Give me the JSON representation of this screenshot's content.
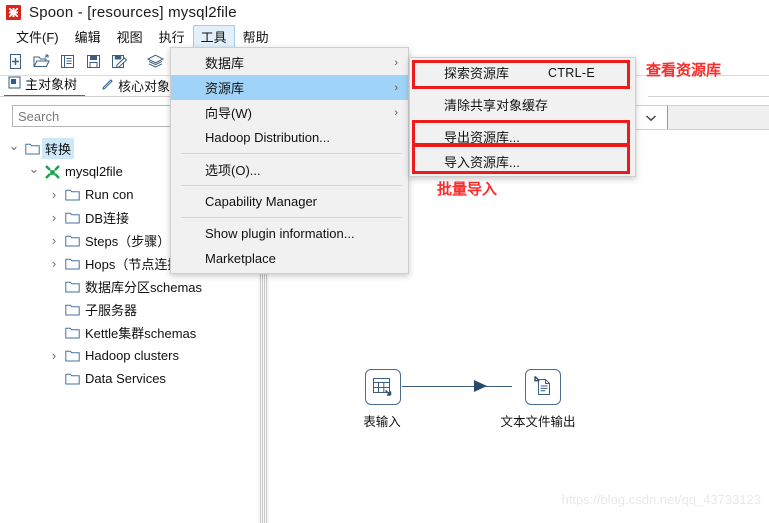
{
  "window": {
    "title": "Spoon - [resources] mysql2file",
    "logo_icon": "spoon-logo-icon"
  },
  "menubar": {
    "items": [
      {
        "label": "文件(F)",
        "active": false
      },
      {
        "label": "编辑",
        "active": false
      },
      {
        "label": "视图",
        "active": false
      },
      {
        "label": "执行",
        "active": false
      },
      {
        "label": "工具",
        "active": true
      },
      {
        "label": "帮助",
        "active": false
      }
    ]
  },
  "toolbar": {
    "buttons": [
      {
        "name": "new-file-icon",
        "title": "新建"
      },
      {
        "name": "open-file-icon",
        "title": "打开"
      },
      {
        "name": "explore-icon",
        "title": "浏览"
      },
      {
        "name": "save-icon",
        "title": "保存"
      },
      {
        "name": "save-as-icon",
        "title": "另存为"
      },
      {
        "name": "layers-icon",
        "title": "图层"
      }
    ]
  },
  "left_panel": {
    "tabs": [
      {
        "label": "主对象树",
        "icon": "tree-view-icon",
        "selected": true
      },
      {
        "label": "核心对象",
        "icon": "pencil-icon",
        "selected": false
      }
    ],
    "search": {
      "placeholder": "Search",
      "value": ""
    },
    "tree": [
      {
        "label": "转换",
        "indent": 0,
        "twisty": "down",
        "icon": "folder-icon",
        "selected": true
      },
      {
        "label": "mysql2file",
        "indent": 1,
        "twisty": "down",
        "icon": "transformation-icon",
        "selected": false
      },
      {
        "label": "Run con",
        "indent": 2,
        "twisty": "right",
        "icon": "folder-icon",
        "selected": false
      },
      {
        "label": "DB连接",
        "indent": 2,
        "twisty": "right",
        "icon": "folder-icon",
        "selected": false
      },
      {
        "label": "Steps（步骤）",
        "indent": 2,
        "twisty": "right",
        "icon": "folder-icon",
        "selected": false
      },
      {
        "label": "Hops（节点连接）",
        "indent": 2,
        "twisty": "right",
        "icon": "folder-icon",
        "selected": false
      },
      {
        "label": "数据库分区schemas",
        "indent": 2,
        "twisty": "none",
        "icon": "folder-icon",
        "selected": false
      },
      {
        "label": "子服务器",
        "indent": 2,
        "twisty": "none",
        "icon": "folder-icon",
        "selected": false
      },
      {
        "label": "Kettle集群schemas",
        "indent": 2,
        "twisty": "none",
        "icon": "folder-icon",
        "selected": false
      },
      {
        "label": "Hadoop clusters",
        "indent": 2,
        "twisty": "right",
        "icon": "folder-icon",
        "selected": false
      },
      {
        "label": "Data Services",
        "indent": 2,
        "twisty": "none",
        "icon": "folder-icon",
        "selected": false
      }
    ]
  },
  "tools_menu": {
    "items": [
      {
        "label": "数据库",
        "submenu": true,
        "highlighted": false,
        "separator_after": false
      },
      {
        "label": "资源库",
        "submenu": true,
        "highlighted": true,
        "separator_after": false
      },
      {
        "label": "向导(W)",
        "submenu": true,
        "highlighted": false,
        "separator_after": false
      },
      {
        "label": "Hadoop Distribution...",
        "submenu": false,
        "highlighted": false,
        "separator_after": true
      },
      {
        "label": "选项(O)...",
        "submenu": false,
        "highlighted": false,
        "separator_after": true
      },
      {
        "label": "Capability Manager",
        "submenu": false,
        "highlighted": false,
        "separator_after": true
      },
      {
        "label": "Show plugin information...",
        "submenu": false,
        "highlighted": false,
        "separator_after": false
      },
      {
        "label": "Marketplace",
        "submenu": false,
        "highlighted": false,
        "separator_after": false
      }
    ]
  },
  "repository_submenu": {
    "items": [
      {
        "label": "探索资源库",
        "accel": "CTRL-E",
        "separator_after": true
      },
      {
        "label": "清除共享对象缓存",
        "accel": "",
        "separator_after": true
      },
      {
        "label": "导出资源库...",
        "accel": "",
        "separator_after": false
      },
      {
        "label": "导入资源库...",
        "accel": "",
        "separator_after": false
      }
    ]
  },
  "annotations": [
    {
      "text": "查看资源库",
      "name": "annotation-view-repository"
    },
    {
      "text": "批量导入",
      "name": "annotation-batch-import"
    }
  ],
  "canvas": {
    "steps": [
      {
        "label": "表输入",
        "icon": "table-input-icon"
      },
      {
        "label": "文本文件输出",
        "icon": "text-file-output-icon"
      }
    ]
  },
  "watermark": {
    "text": "https://blog.csdn.net/qq_43733123"
  }
}
